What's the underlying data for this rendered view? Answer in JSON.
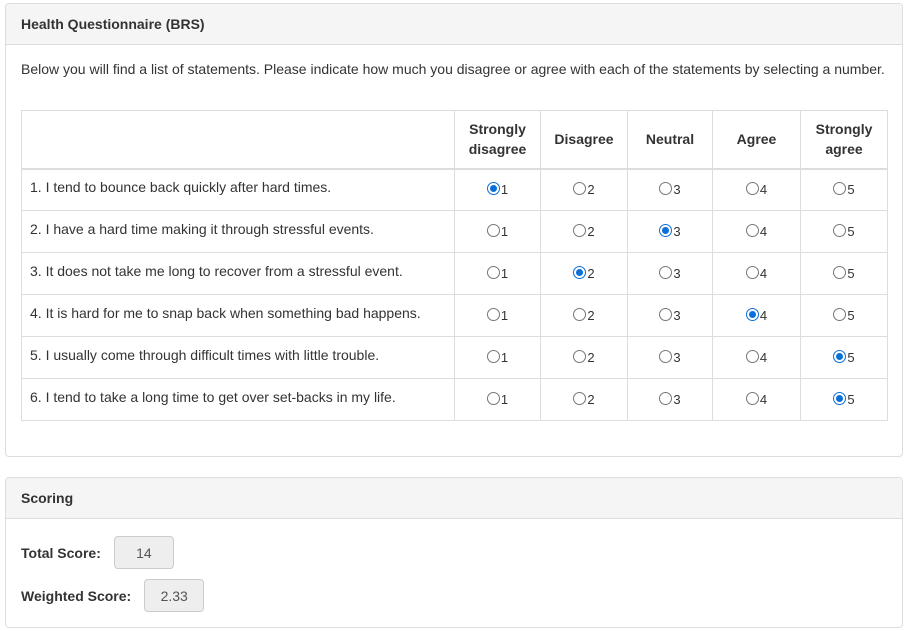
{
  "questionnaire": {
    "title": "Health Questionnaire (BRS)",
    "instructions": "Below you will find a list of statements. Please indicate how much you disagree or agree with each of the statements by selecting a number.",
    "columns": [
      "Strongly disagree",
      "Disagree",
      "Neutral",
      "Agree",
      "Strongly agree"
    ],
    "option_values": [
      "1",
      "2",
      "3",
      "4",
      "5"
    ],
    "items": [
      {
        "text": "1. I tend to bounce back quickly after hard times.",
        "selected": 1
      },
      {
        "text": "2. I have a hard time making it through stressful events.",
        "selected": 3
      },
      {
        "text": "3. It does not take me long to recover from a stressful event.",
        "selected": 2
      },
      {
        "text": "4. It is hard for me to snap back when something bad happens.",
        "selected": 4
      },
      {
        "text": "5. I usually come through difficult times with little trouble.",
        "selected": 5
      },
      {
        "text": "6. I tend to take a long time to get over set-backs in my life.",
        "selected": 5
      }
    ]
  },
  "scoring": {
    "title": "Scoring",
    "total_label": "Total Score:",
    "total_value": "14",
    "weighted_label": "Weighted Score:",
    "weighted_value": "2.33"
  },
  "colors": {
    "radio_checked": "#0b6fd8",
    "panel_border": "#dddddd",
    "heading_bg": "#f5f5f5"
  }
}
